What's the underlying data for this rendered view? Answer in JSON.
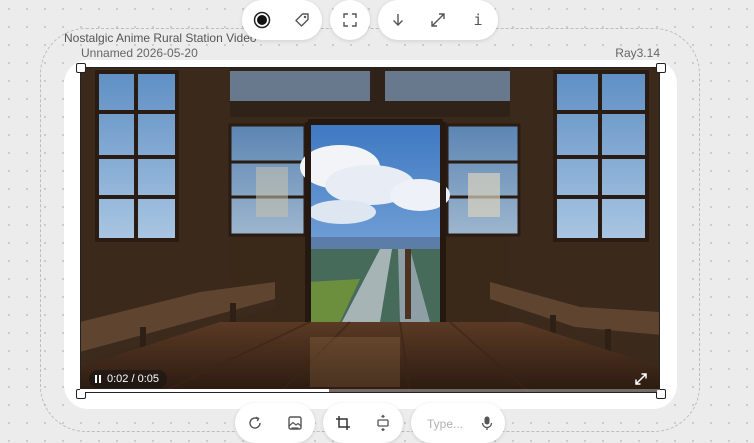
{
  "canvas": {
    "title": "Nostalgic Anime Rural Station Video",
    "subtitle": "Unnamed 2026-05-20",
    "model": "Ray3.14"
  },
  "video": {
    "current_time": "0:02",
    "separator": " / ",
    "duration": "0:05",
    "progress": 0.43,
    "state": "playing"
  },
  "top_toolbar": {
    "groups": [
      {
        "items": [
          "record-icon",
          "tag-icon"
        ]
      },
      {
        "items": [
          "focus-frame-icon"
        ]
      },
      {
        "items": [
          "download-icon",
          "expand-icon",
          "info-icon"
        ]
      }
    ],
    "info_label": "i"
  },
  "bottom_toolbar": {
    "groups": [
      {
        "items": [
          "redo-icon",
          "image-icon"
        ]
      },
      {
        "items": [
          "crop-icon",
          "resize-icon"
        ]
      }
    ]
  },
  "prompt": {
    "placeholder": "Type...",
    "value": ""
  },
  "icons": [
    "pause-icon",
    "fullscreen-icon",
    "microphone-icon"
  ]
}
